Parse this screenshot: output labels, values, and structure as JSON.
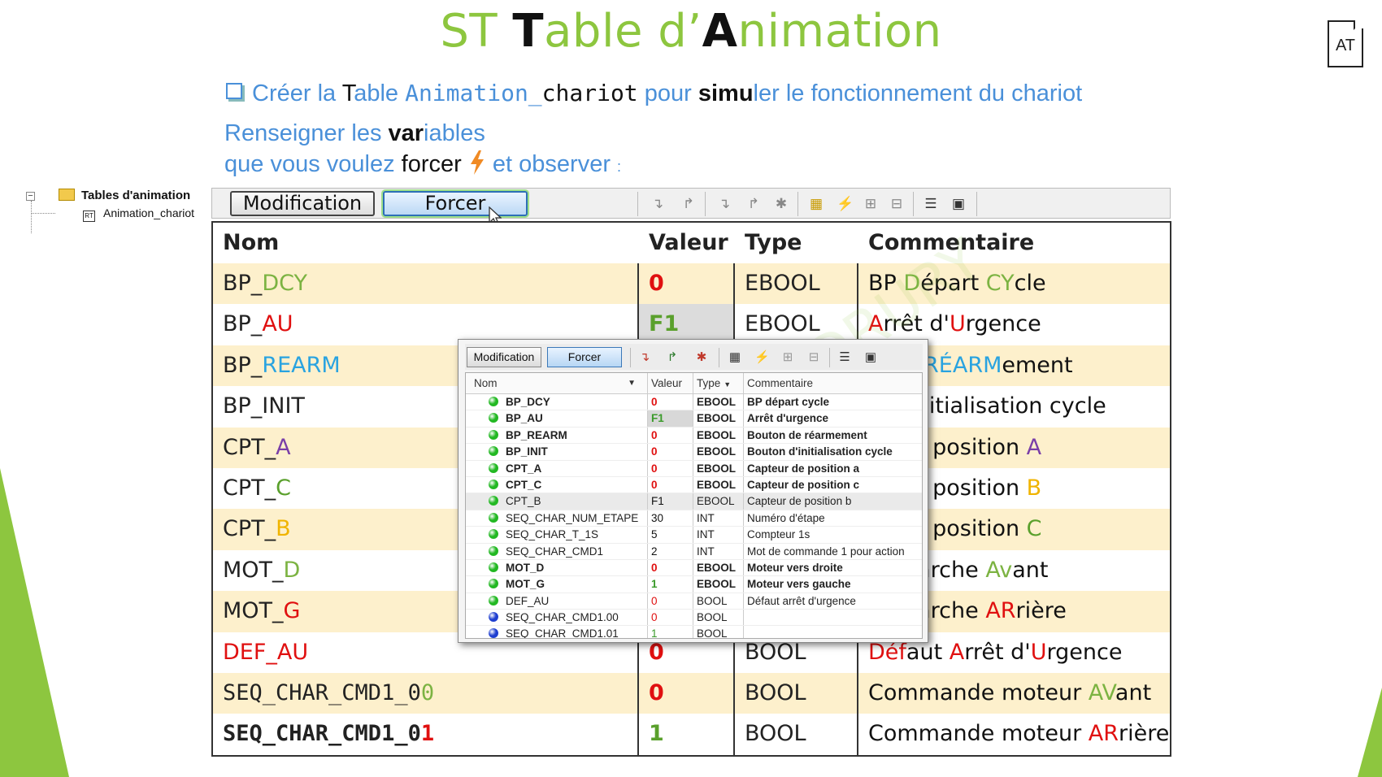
{
  "title": {
    "part1": "ST ",
    "part2": "T",
    "part3": "able d’",
    "part4": "A",
    "part5": "nimation"
  },
  "doc_icon_label": "AT",
  "instruction1": {
    "a": "Créer la ",
    "b": "T",
    "c": "able ",
    "d": "A",
    "e": "nimation_",
    "f": "chariot",
    "g": " pour ",
    "h": "simu",
    "i": "ler le fonctionnement du chariot"
  },
  "instruction2": {
    "a": "Renseigner les ",
    "b": "var",
    "c": "iables"
  },
  "instruction3": {
    "a": "que vous voulez ",
    "b": "forcer",
    "c": " et observer ",
    "d": ":"
  },
  "tree": {
    "root": "Tables d'animation",
    "child": "Animation_chariot",
    "child_icon": "RT",
    "expander": "−"
  },
  "toolbar": {
    "modification": "Modification",
    "forcer": "Forcer"
  },
  "grid": {
    "headers": {
      "nom": "Nom",
      "valeur": "Valeur",
      "type": "Type",
      "commentaire": "Commentaire"
    },
    "rows": [
      {
        "nom_a": "BP_",
        "nom_b": "DCY",
        "nom_b_color": "#7cb342",
        "valeur": "0",
        "valeur_color": "#e01010",
        "type": "EBOOL",
        "com": [
          [
            "BP ",
            "#111"
          ],
          [
            "D",
            "#7cb342"
          ],
          [
            "épart ",
            "#111"
          ],
          [
            "CY",
            "#7cb342"
          ],
          [
            "cle",
            "#111"
          ]
        ]
      },
      {
        "nom_a": "BP_",
        "nom_b": "AU",
        "nom_b_color": "#e01010",
        "valeur": "F1",
        "valeur_color": "#5aa02c",
        "type": "EBOOL",
        "com": [
          [
            "A",
            "#e01010"
          ],
          [
            "rrêt d'",
            "#111"
          ],
          [
            "U",
            "#e01010"
          ],
          [
            "rgence",
            "#111"
          ]
        ]
      },
      {
        "nom_a": "BP_",
        "nom_b": "REARM",
        "nom_b_color": "#29a3e0",
        "valeur": "",
        "valeur_color": "#111",
        "type": "",
        "com": [
          [
            "n de ",
            "#111"
          ],
          [
            "RÉARM",
            "#29a3e0"
          ],
          [
            "ement",
            "#111"
          ]
        ]
      },
      {
        "nom_a": "BP_INIT",
        "nom_b": "",
        "nom_b_color": "#111",
        "valeur": "",
        "valeur_color": "#111",
        "type": "",
        "com": [
          [
            "n d'initialisation cycle",
            "#111"
          ]
        ]
      },
      {
        "nom_a": "CPT_",
        "nom_b": "A",
        "nom_b_color": "#7a3fa8",
        "valeur": "",
        "valeur_color": "#111",
        "type": "",
        "com": [
          [
            "ur de position ",
            "#111"
          ],
          [
            "A",
            "#7a3fa8"
          ]
        ]
      },
      {
        "nom_a": "CPT_",
        "nom_b": "C",
        "nom_b_color": "#5aa02c",
        "valeur": "",
        "valeur_color": "#111",
        "type": "",
        "com": [
          [
            "ur de position ",
            "#111"
          ],
          [
            "B",
            "#f0b400"
          ]
        ]
      },
      {
        "nom_a": "CPT_",
        "nom_b": "B",
        "nom_b_color": "#f0b400",
        "valeur": "",
        "valeur_color": "#111",
        "type": "",
        "com": [
          [
            "ur de position ",
            "#111"
          ],
          [
            "C",
            "#5aa02c"
          ]
        ]
      },
      {
        "nom_a": "MOT_",
        "nom_b": "D",
        "nom_b_color": "#7cb342",
        "valeur": "",
        "valeur_color": "#111",
        "type": "",
        "com": [
          [
            "ur ",
            "#111"
          ],
          [
            "M",
            "#7cb342"
          ],
          [
            "arche ",
            "#111"
          ],
          [
            "Av",
            "#7cb342"
          ],
          [
            "ant",
            "#111"
          ]
        ]
      },
      {
        "nom_a": "MOT_",
        "nom_b": "G",
        "nom_b_color": "#e01010",
        "valeur": "",
        "valeur_color": "#111",
        "type": "",
        "com": [
          [
            "ur ",
            "#111"
          ],
          [
            "M",
            "#e01010"
          ],
          [
            "arche ",
            "#111"
          ],
          [
            "AR",
            "#e01010"
          ],
          [
            "rière",
            "#111"
          ]
        ]
      },
      {
        "nom_a": "DEF_AU",
        "nom_a_color": "#e01010",
        "nom_b": "",
        "nom_b_color": "#e01010",
        "valeur": "0",
        "valeur_color": "#e01010",
        "type": "BOOL",
        "com": [
          [
            "Déf",
            "#e01010"
          ],
          [
            "aut ",
            "#111"
          ],
          [
            "A",
            "#e01010"
          ],
          [
            "rrêt d'",
            "#111"
          ],
          [
            "U",
            "#e01010"
          ],
          [
            "rgence",
            "#111"
          ]
        ]
      },
      {
        "nom_a": "SEQ_CHAR_CMD1_0",
        "nom_b": "0",
        "nom_b_color": "#7cb342",
        "mono": true,
        "valeur": "0",
        "valeur_color": "#e01010",
        "type": "BOOL",
        "com": [
          [
            "Commande moteur ",
            "#111"
          ],
          [
            "AV",
            "#7cb342"
          ],
          [
            "ant",
            "#111"
          ]
        ]
      },
      {
        "nom_a": "SEQ_CHAR_CMD1_0",
        "nom_b": "1",
        "nom_b_color": "#e01010",
        "mono": true,
        "bold": true,
        "valeur": "1",
        "valeur_color": "#5aa02c",
        "type": "BOOL",
        "com": [
          [
            "Commande moteur ",
            "#111"
          ],
          [
            "AR",
            "#e01010"
          ],
          [
            "rière",
            "#111"
          ]
        ]
      }
    ]
  },
  "popup": {
    "modification": "Modification",
    "forcer": "Forcer",
    "headers": {
      "nom": "Nom",
      "valeur": "Valeur",
      "type": "Type",
      "commentaire": "Commentaire"
    },
    "rows": [
      {
        "nom": "BP_DCY",
        "valeur": "0",
        "vcolor": "#e01010",
        "type": "EBOOL",
        "com": "BP départ cycle",
        "dot": "#22b822",
        "bold": true
      },
      {
        "nom": "BP_AU",
        "valeur": "F1",
        "vcolor": "#3a9a2a",
        "type": "EBOOL",
        "com": "Arrêt d'urgence",
        "dot": "#22b822",
        "bold": true,
        "vbg": "#d8d8d8"
      },
      {
        "nom": "BP_REARM",
        "valeur": "0",
        "vcolor": "#e01010",
        "type": "EBOOL",
        "com": "Bouton de réarmement",
        "dot": "#22b822",
        "bold": true
      },
      {
        "nom": "BP_INIT",
        "valeur": "0",
        "vcolor": "#e01010",
        "type": "EBOOL",
        "com": "Bouton d'initialisation cycle",
        "dot": "#22b822",
        "bold": true
      },
      {
        "nom": "CPT_A",
        "valeur": "0",
        "vcolor": "#e01010",
        "type": "EBOOL",
        "com": "Capteur de position a",
        "dot": "#22b822",
        "bold": true
      },
      {
        "nom": "CPT_C",
        "valeur": "0",
        "vcolor": "#e01010",
        "type": "EBOOL",
        "com": "Capteur de position c",
        "dot": "#22b822",
        "bold": true
      },
      {
        "nom": "CPT_B",
        "valeur": "F1",
        "vcolor": "#111",
        "type": "EBOOL",
        "com": "Capteur de position b",
        "dot": "#22b822",
        "bold": false,
        "sel": true
      },
      {
        "nom": "SEQ_CHAR_NUM_ETAPE",
        "valeur": "30",
        "vcolor": "#111",
        "type": "INT",
        "com": "Numéro d'étape",
        "dot": "#22b822",
        "bold": false
      },
      {
        "nom": "SEQ_CHAR_T_1S",
        "valeur": "5",
        "vcolor": "#111",
        "type": "INT",
        "com": "Compteur 1s",
        "dot": "#22b822",
        "bold": false
      },
      {
        "nom": "SEQ_CHAR_CMD1",
        "valeur": "2",
        "vcolor": "#111",
        "type": "INT",
        "com": "Mot de commande 1 pour action",
        "dot": "#22b822",
        "bold": false
      },
      {
        "nom": "MOT_D",
        "valeur": "0",
        "vcolor": "#e01010",
        "type": "EBOOL",
        "com": "Moteur vers droite",
        "dot": "#22b822",
        "bold": true
      },
      {
        "nom": "MOT_G",
        "valeur": "1",
        "vcolor": "#3a9a2a",
        "type": "EBOOL",
        "com": "Moteur vers gauche",
        "dot": "#22b822",
        "bold": true
      },
      {
        "nom": "DEF_AU",
        "valeur": "0",
        "vcolor": "#e01010",
        "type": "BOOL",
        "com": "Défaut arrêt d'urgence",
        "dot": "#22b822",
        "bold": false
      },
      {
        "nom": "SEQ_CHAR_CMD1.00",
        "valeur": "0",
        "vcolor": "#e01010",
        "type": "BOOL",
        "com": "",
        "dot": "#1f3fd0",
        "bold": false
      },
      {
        "nom": "SEQ_CHAR_CMD1.01",
        "valeur": "1",
        "vcolor": "#3a9a2a",
        "type": "BOOL",
        "com": "",
        "dot": "#1f3fd0",
        "bold": false
      }
    ]
  }
}
